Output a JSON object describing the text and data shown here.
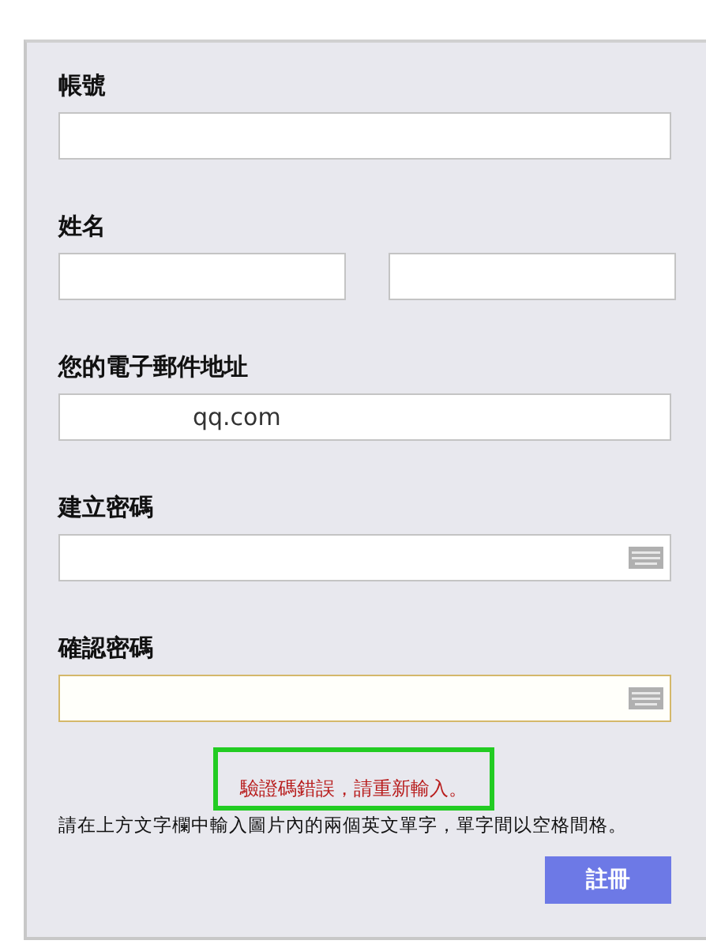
{
  "fields": [
    {
      "label": "帳號",
      "kind": "single",
      "inputs": [
        {
          "focused": false
        }
      ]
    },
    {
      "label": "姓名",
      "kind": "pair",
      "inputs": [
        {
          "focused": false
        },
        {
          "focused": false
        }
      ]
    },
    {
      "label": "您的電子郵件地址",
      "kind": "single",
      "inputs": [
        {
          "value": "qq.com",
          "focused": false
        }
      ]
    },
    {
      "label": "建立密碼",
      "kind": "single",
      "inputs": [
        {
          "keyboard": true,
          "focused": false
        }
      ]
    },
    {
      "label": "確認密碼",
      "kind": "single",
      "inputs": [
        {
          "keyboard": true,
          "focused": true
        }
      ]
    }
  ],
  "error": "驗證碼錯誤，請重新輸入。",
  "hint": "請在上方文字欄中輸入圖片內的兩個英文單字，單字間以空格間格。",
  "submit": "註冊"
}
